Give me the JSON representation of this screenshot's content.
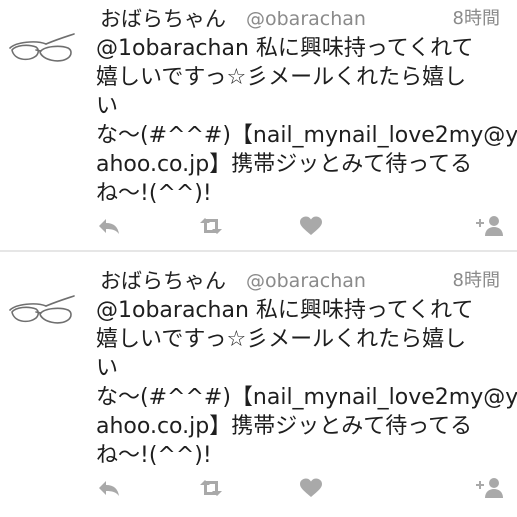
{
  "tweets": [
    {
      "display_name": "おばらちゃん",
      "handle": "@obarachan",
      "time": "8時間",
      "body_lines": [
        "@1obarachan 私に興味持ってくれて",
        "嬉しいですっ☆彡メールくれたら嬉し",
        "い",
        "な〜(#^^#)【nail_mynail_love2my@y",
        "ahoo.co.jp】携帯ジッとみて待ってる",
        "ね〜!(^^)!"
      ],
      "avatar_icon": "glasses-icon",
      "action_icons": [
        "reply-icon",
        "retweet-icon",
        "heart-icon",
        "follow-user-icon"
      ]
    },
    {
      "display_name": "おばらちゃん",
      "handle": "@obarachan",
      "time": "8時間",
      "body_lines": [
        "@1obarachan 私に興味持ってくれて",
        "嬉しいですっ☆彡メールくれたら嬉し",
        "い",
        "な〜(#^^#)【nail_mynail_love2my@y",
        "ahoo.co.jp】携帯ジッとみて待ってる",
        "ね〜!(^^)!"
      ],
      "avatar_icon": "glasses-icon",
      "action_icons": [
        "reply-icon",
        "retweet-icon",
        "heart-icon",
        "follow-user-icon"
      ]
    }
  ],
  "colors": {
    "text": "#1e1e1e",
    "muted": "#8a8a8a",
    "icon": "#a9a9a9",
    "divider": "#e6e6e6"
  }
}
